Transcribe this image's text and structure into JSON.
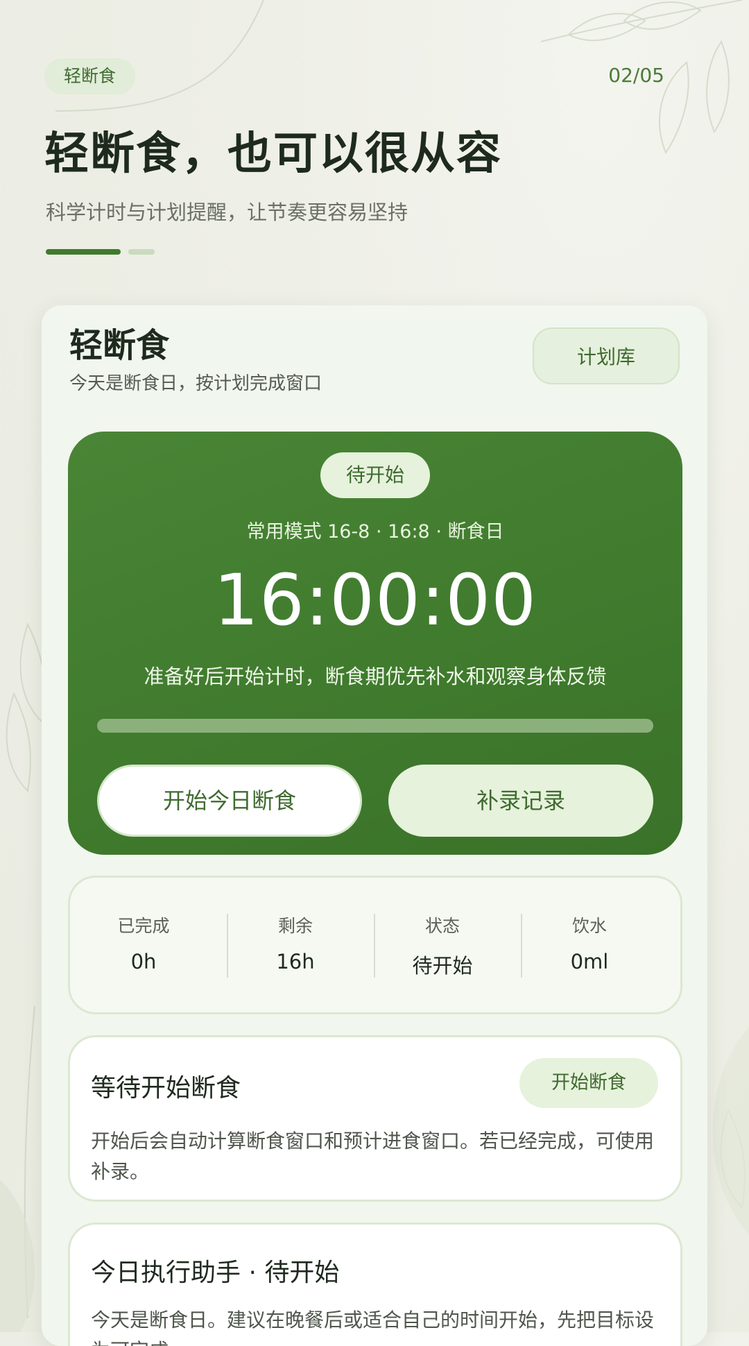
{
  "header": {
    "tag": "轻断食",
    "page_counter": "02/05",
    "title": "轻断食，也可以很从容",
    "subtitle": "科学计时与计划提醒，让节奏更容易坚持"
  },
  "app": {
    "title": "轻断食",
    "subtitle": "今天是断食日，按计划完成窗口",
    "plan_library_label": "计划库"
  },
  "timer": {
    "status": "待开始",
    "mode": "常用模式 16-8 · 16:8 · 断食日",
    "time": "16:00:00",
    "hint": "准备好后开始计时，断食期优先补水和观察身体反馈",
    "progress": 0,
    "start_label": "开始今日断食",
    "backfill_label": "补录记录"
  },
  "stats": [
    {
      "label": "已完成",
      "value": "0h"
    },
    {
      "label": "剩余",
      "value": "16h"
    },
    {
      "label": "状态",
      "value": "待开始"
    },
    {
      "label": "饮水",
      "value": "0ml"
    }
  ],
  "waiting_card": {
    "title": "等待开始断食",
    "button_label": "开始断食",
    "description": "开始后会自动计算断食窗口和预计进食窗口。若已经完成，可使用补录。"
  },
  "assistant_card": {
    "title": "今日执行助手 · 待开始",
    "description": "今天是断食日。建议在晚餐后或适合自己的时间开始，先把目标设为可完成。"
  },
  "colors": {
    "accent": "#3f7a2d",
    "accent_light": "#e6f2dc",
    "background": "#eeefe6"
  }
}
